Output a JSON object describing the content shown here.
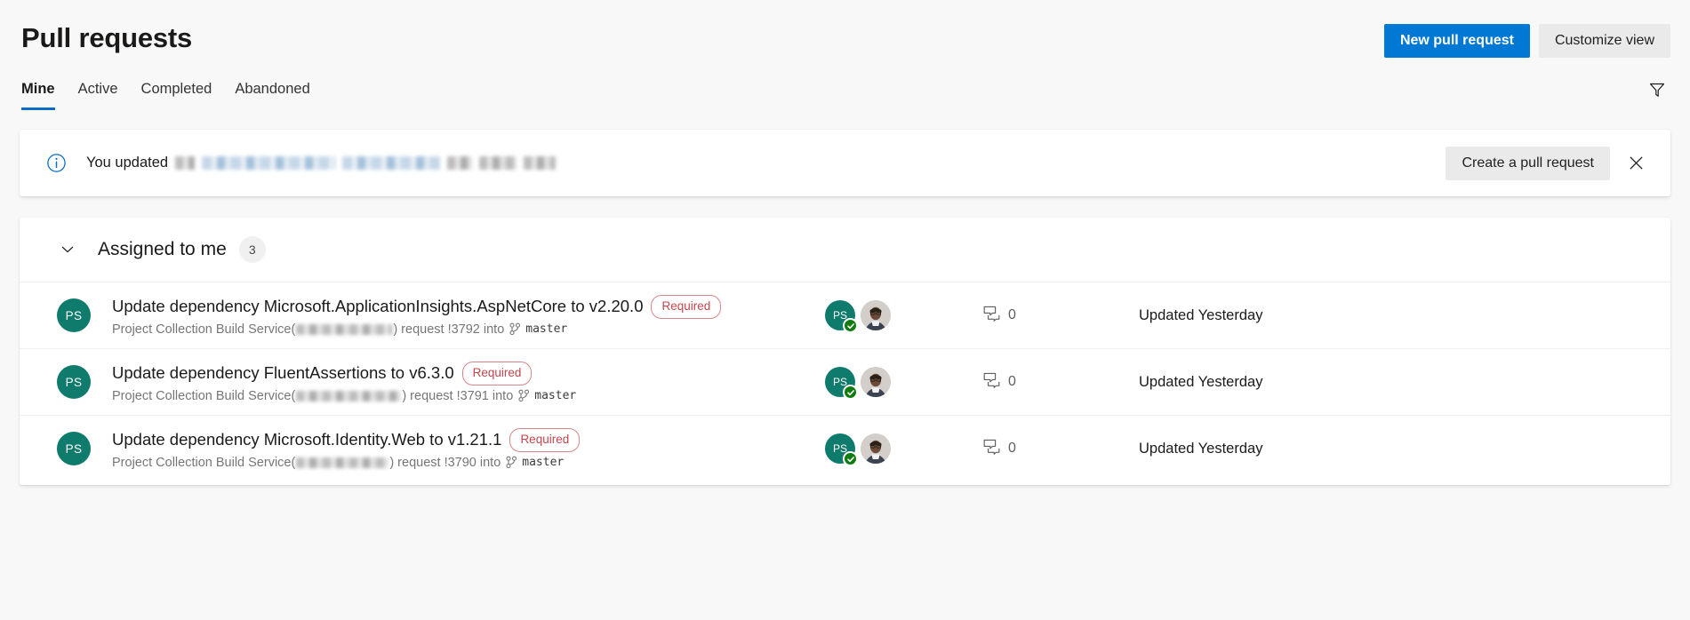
{
  "header": {
    "title": "Pull requests",
    "new_pr_label": "New pull request",
    "customize_label": "Customize view"
  },
  "tabs": [
    {
      "label": "Mine",
      "selected": true
    },
    {
      "label": "Active",
      "selected": false
    },
    {
      "label": "Completed",
      "selected": false
    },
    {
      "label": "Abandoned",
      "selected": false
    }
  ],
  "filter": {
    "icon": "filter-icon"
  },
  "banner": {
    "info_icon": "info-icon",
    "text": "You updated",
    "redacted_note": "branch name redacted",
    "create_pr_label": "Create a pull request",
    "close_icon": "close-icon"
  },
  "group": {
    "chevron_icon": "chevron-down-icon",
    "title": "Assigned to me",
    "count": "3"
  },
  "pull_requests": [
    {
      "avatar_initials": "PS",
      "title": "Update dependency Microsoft.ApplicationInsights.AspNetCore to v2.20.0",
      "badge": "Required",
      "author": "Project Collection Build Service",
      "request_text": ") request !3792 into",
      "open_paren": "(",
      "branch": "master",
      "reviewer_initials": "PS",
      "comment_count": "0",
      "updated": "Updated Yesterday"
    },
    {
      "avatar_initials": "PS",
      "title": "Update dependency FluentAssertions to v6.3.0",
      "badge": "Required",
      "author": "Project Collection Build Service",
      "request_text": ") request !3791 into",
      "open_paren": "(",
      "branch": "master",
      "reviewer_initials": "PS",
      "comment_count": "0",
      "updated": "Updated Yesterday"
    },
    {
      "avatar_initials": "PS",
      "title": "Update dependency Microsoft.Identity.Web to v1.21.1",
      "badge": "Required",
      "author": "Project Collection Build Service",
      "request_text": ") request !3790 into",
      "open_paren": "(",
      "branch": "master",
      "reviewer_initials": "PS",
      "comment_count": "0",
      "updated": "Updated Yesterday"
    }
  ],
  "colors": {
    "accent": "#0078d4",
    "tab_underline": "#0a6cc4",
    "required_badge": "#c4454d",
    "avatar": "#0f7b6c",
    "approved": "#107c10",
    "page_bg": "#f8f8f8"
  }
}
